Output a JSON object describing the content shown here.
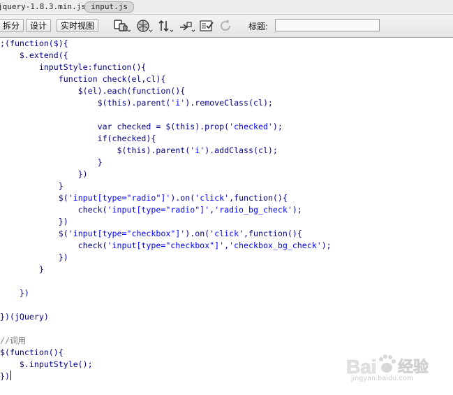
{
  "file_tabs": [
    {
      "label": "jquery-1.8.3.min.js",
      "active": false
    },
    {
      "label": "input.js",
      "active": true
    }
  ],
  "toolbar": {
    "buttons": [
      "拆分",
      "设计",
      "实时视图"
    ],
    "icons": [
      "multiscreen-icon",
      "browser-preview-icon",
      "file-management-icon",
      "visual-aids-icon",
      "validate-icon",
      "refresh-icon"
    ],
    "title_label": "标题:",
    "title_value": ""
  },
  "code_lines": [
    ";(function($){",
    "    $.extend({",
    "        inputStyle:function(){",
    "            function check(el,cl){",
    "                $(el).each(function(){",
    "                    $(this).parent('i').removeClass(cl);",
    "",
    "                    var checked = $(this).prop('checked');",
    "                    if(checked){",
    "                        $(this).parent('i').addClass(cl);",
    "                    }",
    "                })",
    "            }",
    "            $('input[type=\"radio\"]').on('click',function(){",
    "                check('input[type=\"radio\"]','radio_bg_check');",
    "            })",
    "            $('input[type=\"checkbox\"]').on('click',function(){",
    "                check('input[type=\"checkbox\"]','checkbox_bg_check');",
    "            })",
    "        }",
    "",
    "    })",
    "",
    "})(jQuery)",
    "",
    "//调用",
    "$(function(){",
    "    $.inputStyle();",
    "})"
  ],
  "watermark": {
    "brand": "Bai",
    "brand2": "经验",
    "url": "jingyan.baidu.com"
  }
}
